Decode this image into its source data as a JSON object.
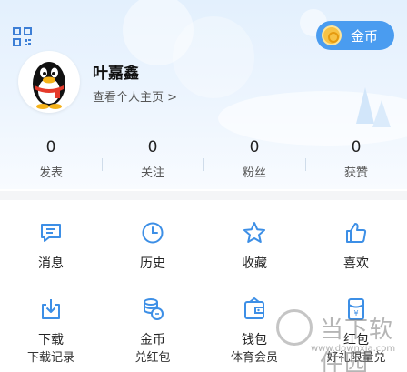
{
  "header": {
    "coin_label": "金币",
    "username": "叶嘉鑫",
    "profile_link": "查看个人主页 >"
  },
  "stats": [
    {
      "value": "0",
      "label": "发表"
    },
    {
      "value": "0",
      "label": "关注"
    },
    {
      "value": "0",
      "label": "粉丝"
    },
    {
      "value": "0",
      "label": "获赞"
    }
  ],
  "menu_row1": [
    {
      "label": "消息",
      "icon": "message-icon"
    },
    {
      "label": "历史",
      "icon": "clock-icon"
    },
    {
      "label": "收藏",
      "icon": "star-icon"
    },
    {
      "label": "喜欢",
      "icon": "thumbs-up-icon"
    }
  ],
  "menu_row2": [
    {
      "label": "下载",
      "icon": "download-icon"
    },
    {
      "label": "金币",
      "icon": "coins-icon"
    },
    {
      "label": "钱包",
      "icon": "wallet-icon"
    },
    {
      "label": "红包",
      "icon": "red-packet-icon"
    }
  ],
  "menu_row3": [
    {
      "label": "下载记录"
    },
    {
      "label": "兑红包"
    },
    {
      "label": "体育会员"
    },
    {
      "label": "好礼限量兑"
    }
  ],
  "watermark": {
    "text": "当下软件园",
    "url": "www.downxia.com"
  },
  "colors": {
    "accent": "#4a9cf0",
    "icon_blue": "#3d8fe6",
    "coin_gold": "#f7c245"
  }
}
